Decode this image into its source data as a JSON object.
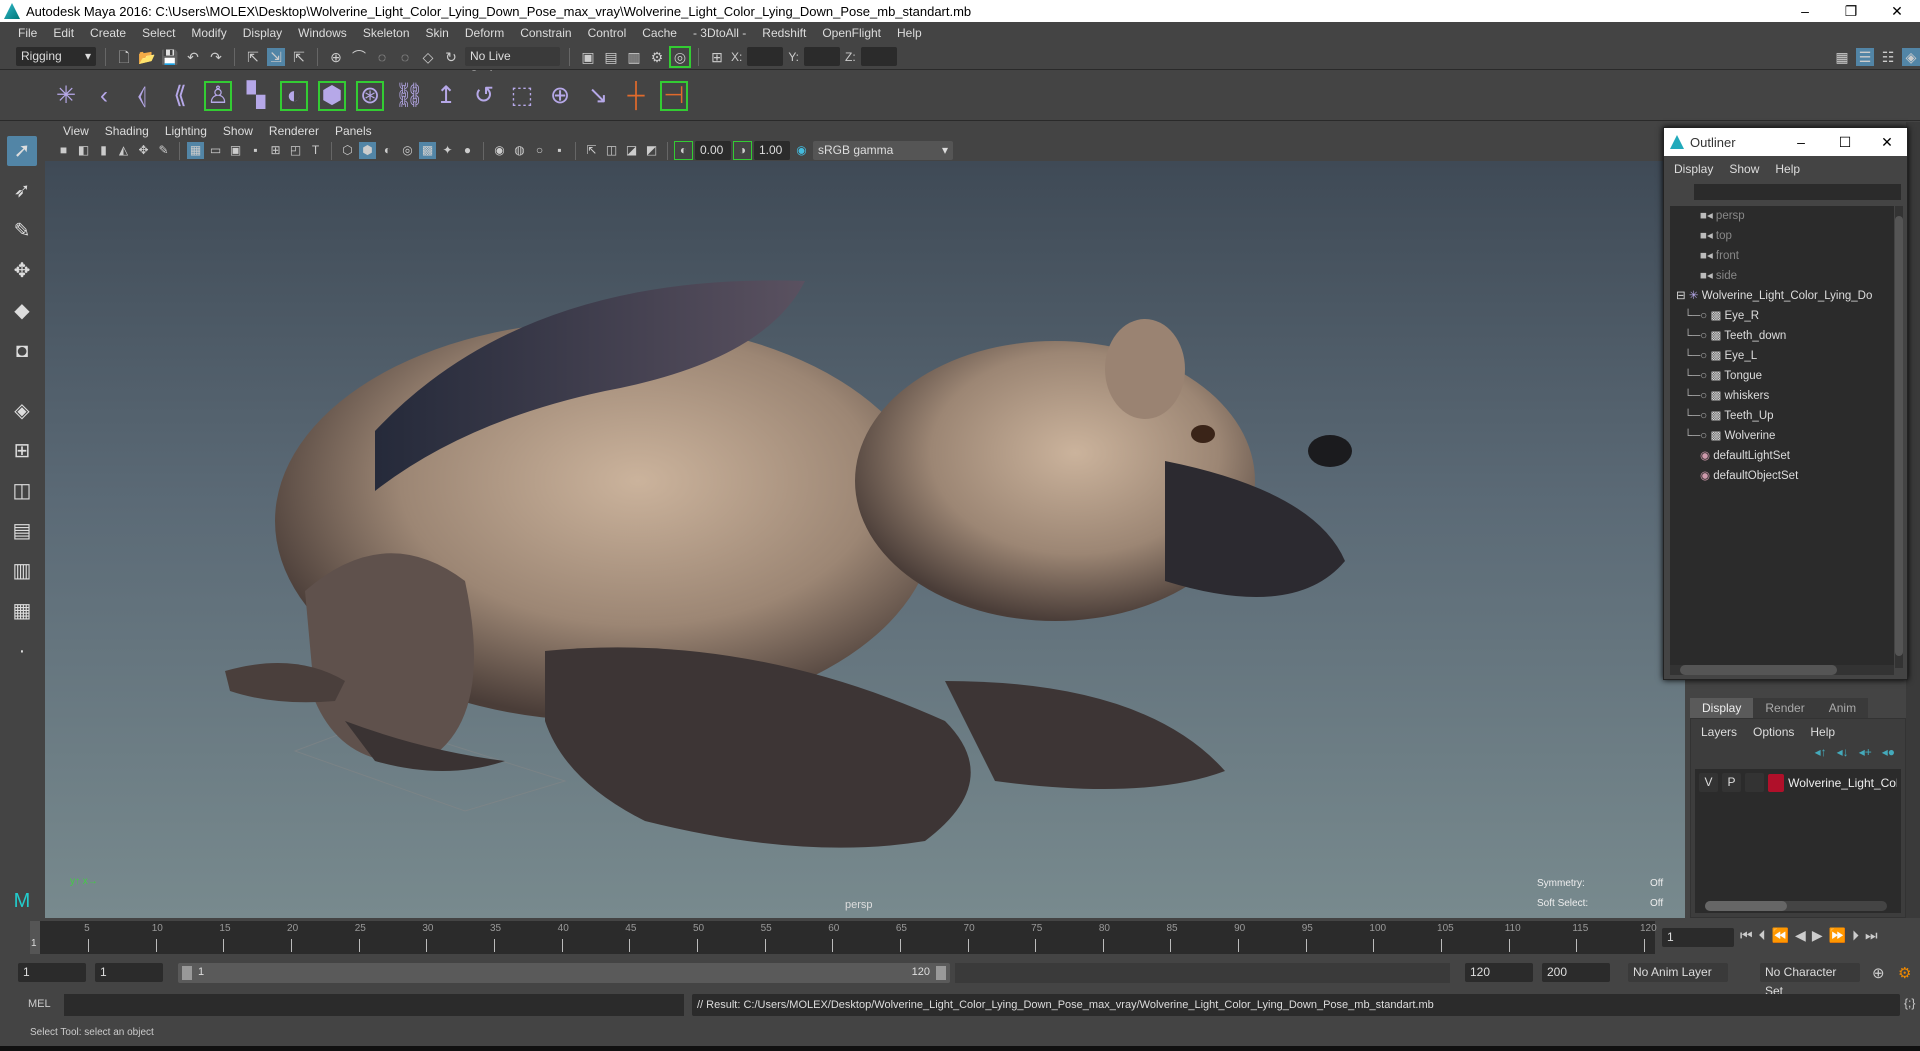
{
  "title": "Autodesk Maya 2016: C:\\Users\\MOLEX\\Desktop\\Wolverine_Light_Color_Lying_Down_Pose_max_vray\\Wolverine_Light_Color_Lying_Down_Pose_mb_standart.mb",
  "menu": [
    "File",
    "Edit",
    "Create",
    "Select",
    "Modify",
    "Display",
    "Windows",
    "Skeleton",
    "Skin",
    "Deform",
    "Constrain",
    "Control",
    "Cache",
    "- 3DtoAll -",
    "Redshift",
    "OpenFlight",
    "Help"
  ],
  "status": {
    "menuset": "Rigging",
    "live_surface": "No Live Surface",
    "x_label": "X:",
    "y_label": "Y:",
    "z_label": "Z:"
  },
  "viewport": {
    "menu": [
      "View",
      "Shading",
      "Lighting",
      "Show",
      "Renderer",
      "Panels"
    ],
    "exposure": "0.00",
    "gamma": "1.00",
    "colorspace": "sRGB gamma",
    "camera": "persp",
    "symmetry_label": "Symmetry:",
    "symmetry_value": "Off",
    "soft_label": "Soft Select:",
    "soft_value": "Off"
  },
  "outliner": {
    "title": "Outliner",
    "menu": [
      "Display",
      "Show",
      "Help"
    ],
    "cameras": [
      "persp",
      "top",
      "front",
      "side"
    ],
    "group": "Wolverine_Light_Color_Lying_Do",
    "children": [
      "Eye_R",
      "Teeth_down",
      "Eye_L",
      "Tongue",
      "whiskers",
      "Teeth_Up",
      "Wolverine"
    ],
    "sets": [
      "defaultLightSet",
      "defaultObjectSet"
    ]
  },
  "layers": {
    "tabs": [
      "Display",
      "Render",
      "Anim"
    ],
    "menu": [
      "Layers",
      "Options",
      "Help"
    ],
    "v": "V",
    "p": "P",
    "layer_name": "Wolverine_Light_Color",
    "layer_color": "#b0102a"
  },
  "timeline": {
    "start": 1,
    "end": 120,
    "ticks": [
      5,
      10,
      15,
      20,
      25,
      30,
      35,
      40,
      45,
      50,
      55,
      60,
      65,
      70,
      75,
      80,
      85,
      90,
      95,
      100,
      105,
      110,
      115,
      120
    ],
    "current": "1",
    "current_label": "1"
  },
  "range": {
    "start": "1",
    "inner_start": "1",
    "slider_start": "1",
    "slider_end": "120",
    "end": "120",
    "anim_end": "200",
    "anim_layer": "No Anim Layer",
    "character_set": "No Character Set"
  },
  "mel": {
    "label": "MEL",
    "result": "// Result: C:/Users/MOLEX/Desktop/Wolverine_Light_Color_Lying_Down_Pose_max_vray/Wolverine_Light_Color_Lying_Down_Pose_mb_standart.mb"
  },
  "help": "Select Tool: select an object"
}
